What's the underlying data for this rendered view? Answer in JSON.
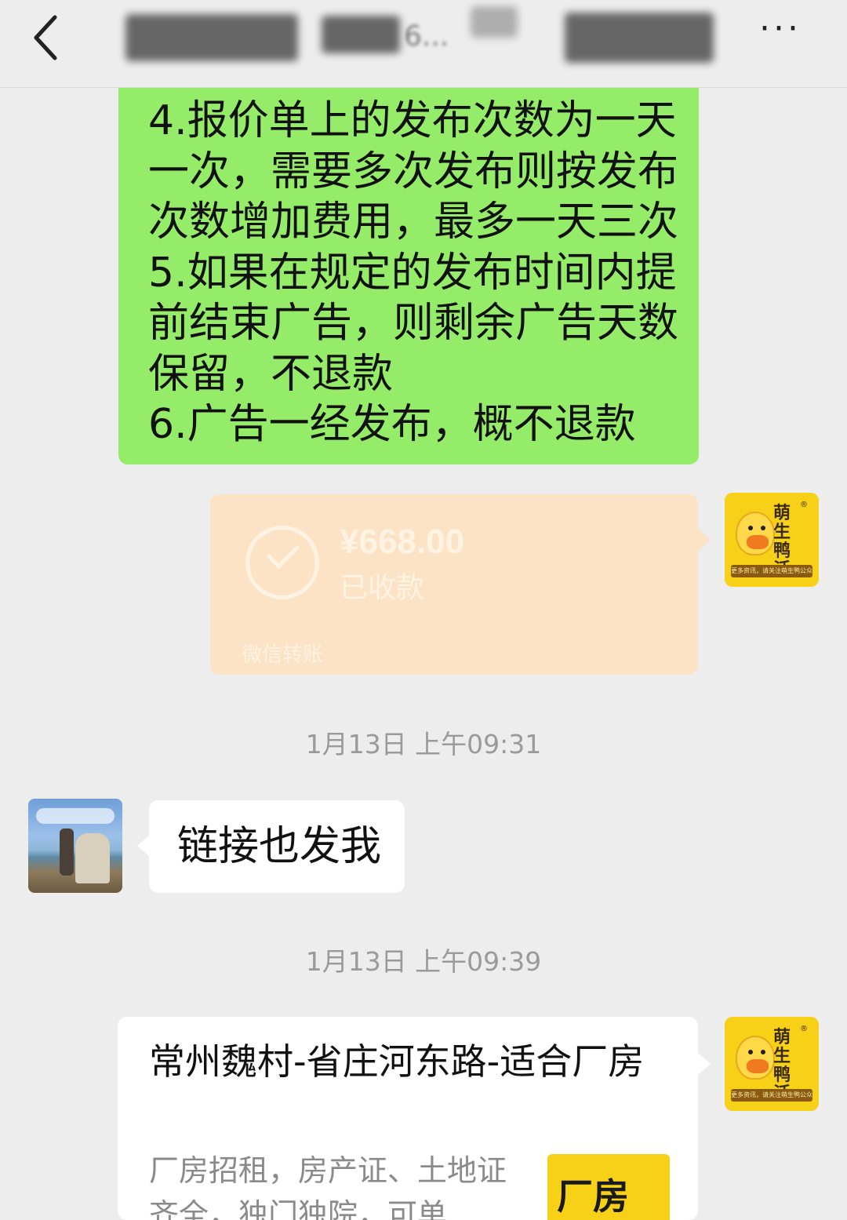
{
  "header": {
    "title_visible_fragment": "6...",
    "more_label": "···"
  },
  "messages": {
    "terms": {
      "text": "4.报价单上的发布次数为一天\n一次，需要多次发布则按发布\n次数增加费用，最多一天三次\n5.如果在规定的发布时间内提\n前结束广告，则剩余广告天数\n保留，不退款\n6.广告一经发布，概不退款"
    },
    "transfer": {
      "amount": "¥668.00",
      "status": "已收款",
      "source": "微信转账"
    },
    "timestamp1": "1月13日 上午09:31",
    "reply": {
      "text": "链接也发我"
    },
    "timestamp2": "1月13日 上午09:39",
    "link_card": {
      "title": "常州魏村-省庄河东路-适合厂房",
      "description": "厂房招租，房产证、土地证齐全，独门独院，可单",
      "thumb_label": "厂房"
    }
  },
  "avatars": {
    "duck_brand": "萌生鸭活",
    "duck_strip": "更多资讯，请关注萌生鸭公众号",
    "duck_reg": "®"
  },
  "colors": {
    "background": "#ededed",
    "sent_bubble": "#95ec69",
    "received_bubble": "#ffffff",
    "transfer_card": "#fde3c6",
    "brand_yellow": "#f7d117"
  }
}
